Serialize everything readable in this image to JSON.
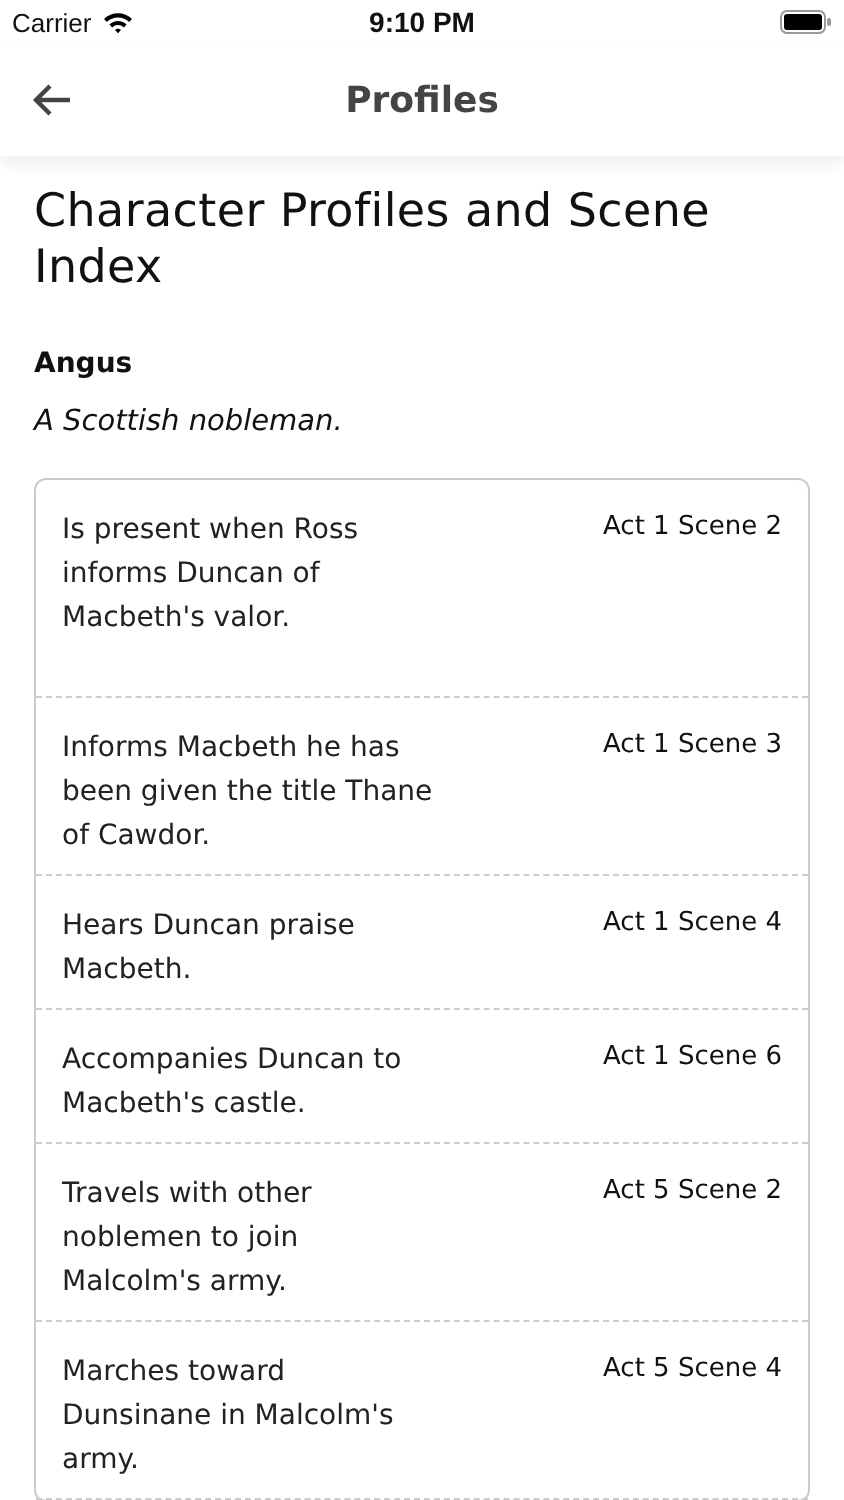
{
  "status_bar": {
    "carrier": "Carrier",
    "time": "9:10 PM"
  },
  "nav": {
    "title": "Profiles"
  },
  "heading": "Character Profiles and Scene Index",
  "character": {
    "name": "Angus",
    "description": "A Scottish nobleman."
  },
  "scenes": [
    {
      "text": "Is present when Ross informs Duncan of Macbeth's valor.",
      "scene": "Act 1 Scene 2"
    },
    {
      "text": "Informs Macbeth he has been given the title Thane of Cawdor.",
      "scene": "Act 1 Scene 3"
    },
    {
      "text": "Hears Duncan praise Macbeth.",
      "scene": "Act 1 Scene 4"
    },
    {
      "text": "Accompanies Duncan to Macbeth's castle.",
      "scene": "Act 1 Scene 6"
    },
    {
      "text": "Travels with other noblemen to join Malcolm's army.",
      "scene": "Act 5 Scene 2"
    },
    {
      "text": "Marches toward Dunsinane in Malcolm's army.",
      "scene": "Act 5 Scene 4"
    }
  ]
}
